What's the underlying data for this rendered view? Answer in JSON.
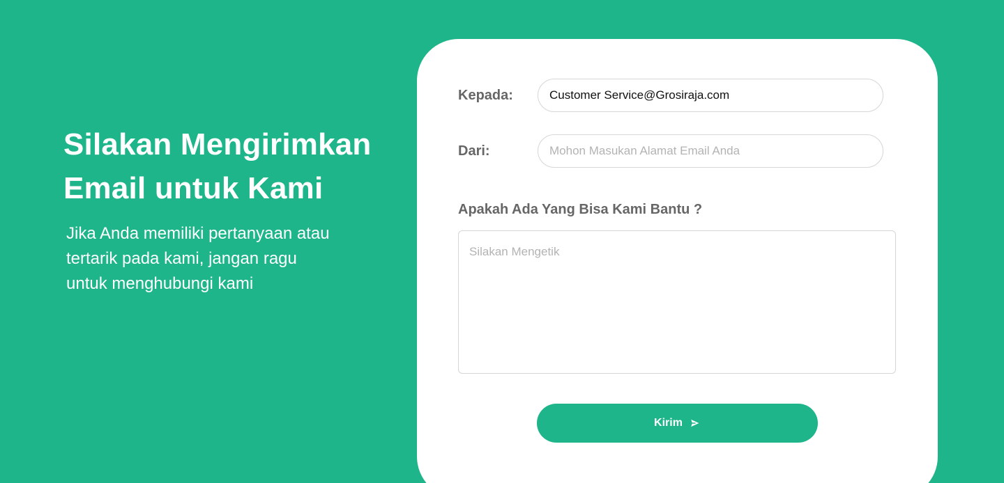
{
  "intro": {
    "title_line1": "Silakan Mengirimkan",
    "title_line2": "Email untuk Kami",
    "text_line1": "Jika Anda memiliki pertanyaan atau",
    "text_line2": "tertarik pada kami, jangan ragu",
    "text_line3": "untuk menghubungi kami"
  },
  "form": {
    "to_label": "Kepada:",
    "to_value": "Customer Service@Grosiraja.com",
    "from_label": "Dari:",
    "from_value": "",
    "from_placeholder": "Mohon Masukan Alamat Email Anda",
    "question": "Apakah Ada Yang Bisa Kami Bantu ?",
    "message_value": "",
    "message_placeholder": "Silakan Mengetik",
    "send_label": "Kirim",
    "send_icon": "send-icon"
  },
  "colors": {
    "brand": "#1eb58a",
    "card": "#ffffff",
    "label": "#666666",
    "placeholder": "#b3b3b3"
  }
}
